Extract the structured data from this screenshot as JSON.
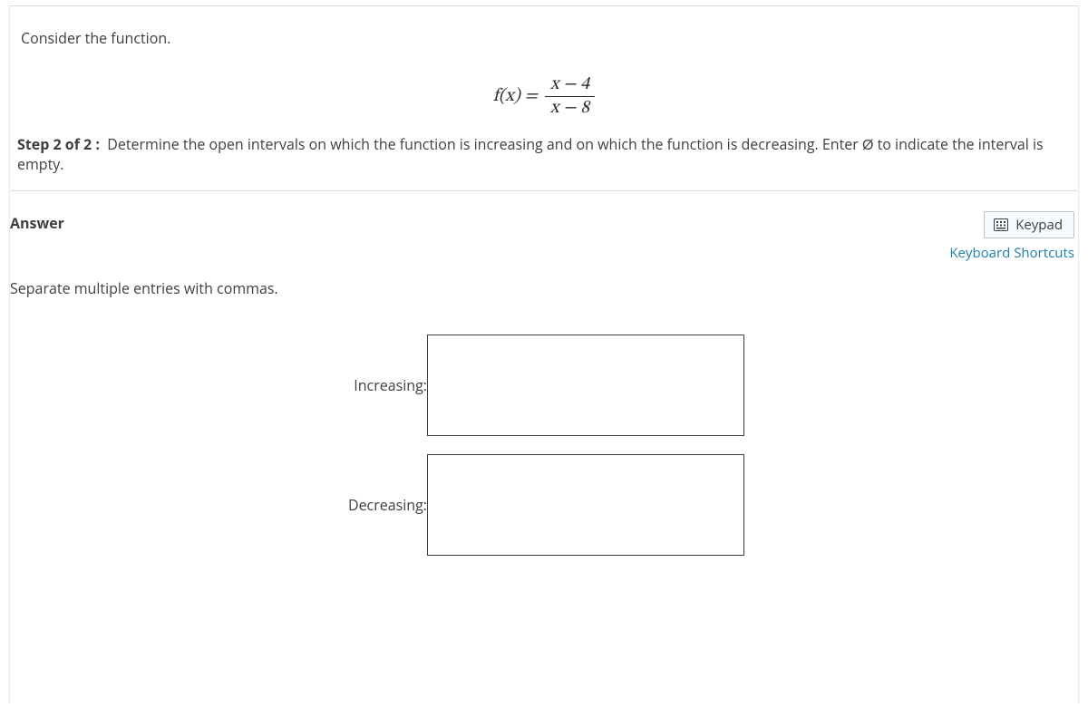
{
  "question": {
    "prompt": "Consider the function.",
    "formula": {
      "lhs": "f(x) =",
      "numerator": "x − 4",
      "denominator": "x − 8"
    },
    "step_label": "Step 2 of 2 :",
    "step_text_before": "Determine the open intervals on which the function is increasing and on which the function is decreasing. Enter",
    "step_symbol": "Ø",
    "step_text_after": "to indicate the interval is empty."
  },
  "answer": {
    "title": "Answer",
    "keypad_label": "Keypad",
    "shortcuts_label": "Keyboard Shortcuts",
    "instruction": "Separate multiple entries with commas.",
    "fields": {
      "increasing": {
        "label": "Increasing:",
        "value": ""
      },
      "decreasing": {
        "label": "Decreasing:",
        "value": ""
      }
    }
  }
}
